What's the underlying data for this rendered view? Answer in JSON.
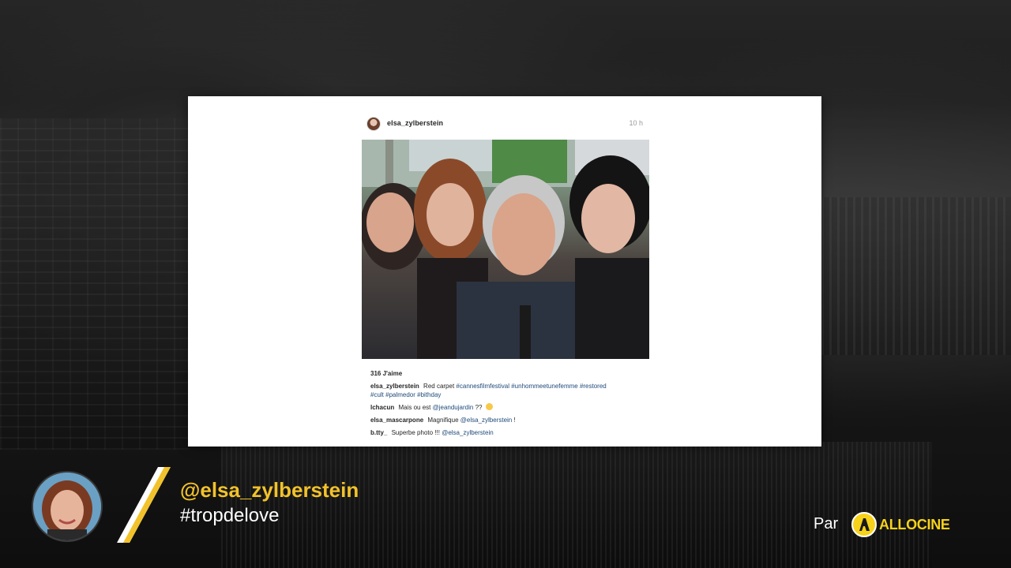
{
  "post": {
    "username": "elsa_zylberstein",
    "time": "10 h",
    "likes": "316 J'aime",
    "caption": {
      "user": "elsa_zylberstein",
      "text": "Red carpet",
      "tags_line1": "#cannesfilmfestival #unhommeetunefemme #restored",
      "tags_line2": "#cult #palmedor #bithday"
    },
    "comments": [
      {
        "user": "lchacun",
        "text": "Mais ou est",
        "mention": "@jeandujardin",
        "suffix": "??"
      },
      {
        "user": "elsa_mascarpone",
        "text": "Magnifique",
        "mention": "@elsa_zylberstein",
        "suffix": "!"
      },
      {
        "user": "b.tty_",
        "text": "Superbe photo !!!",
        "mention": "@elsa_zylberstein",
        "suffix": ""
      }
    ]
  },
  "lower_third": {
    "handle": "@elsa_zylberstein",
    "hashtag": "#tropdelove",
    "by_label": "Par",
    "brand": "ALLOCINE"
  },
  "colors": {
    "handle": "#f2c22b",
    "brand": "#f6d21b",
    "tag": "#1f4a7a"
  },
  "icons": {
    "emoji": "smiling-face-icon",
    "brand_badge": "allocine-logo-icon"
  }
}
